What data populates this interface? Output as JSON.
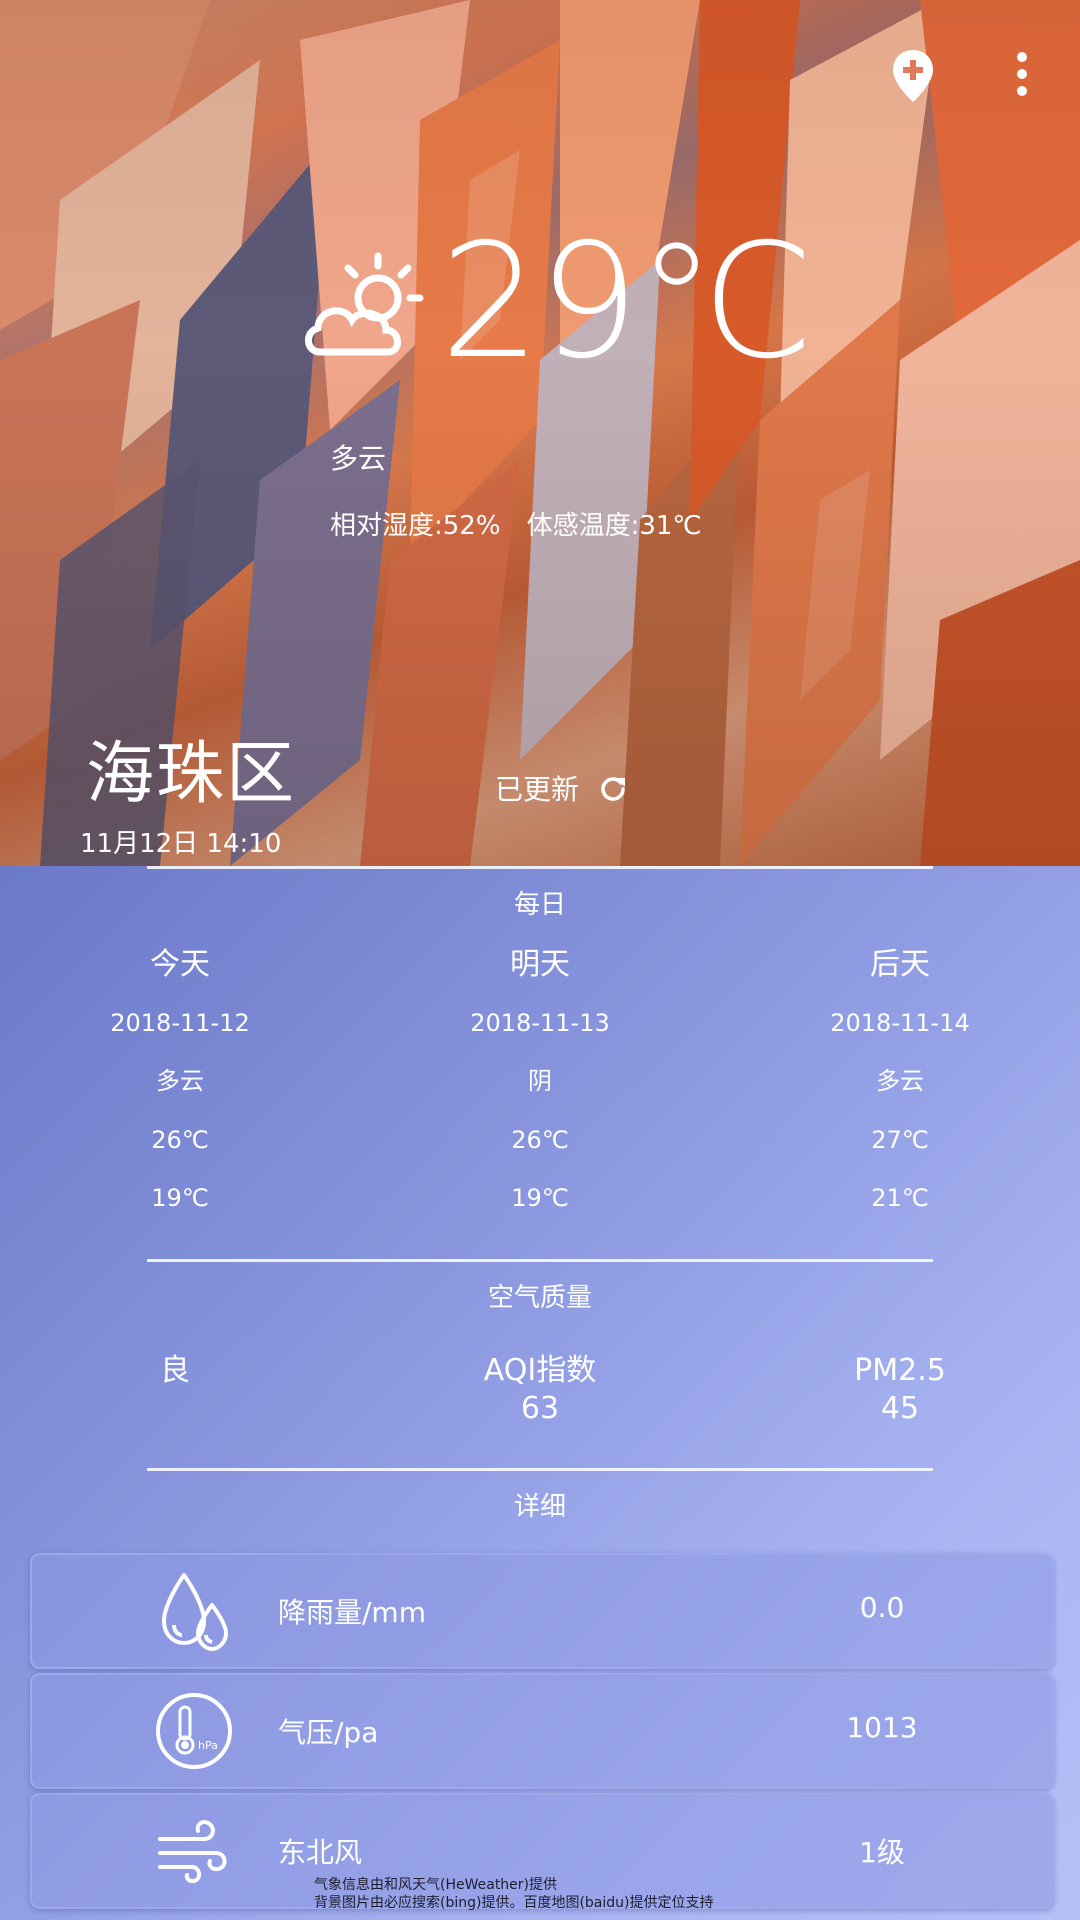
{
  "current": {
    "temperature": "29℃",
    "condition": "多云",
    "humidity": "相对湿度:52%",
    "feels_like": "体感温度:31℃",
    "weather_icon": "partly-cloudy-icon"
  },
  "location": {
    "city": "海珠区",
    "datetime": "11月12日 14:10",
    "updated_label": "已更新"
  },
  "daily": {
    "title": "每日",
    "days": [
      {
        "label": "今天",
        "date": "2018-11-12",
        "weather": "多云",
        "high": "26℃",
        "low": "19℃"
      },
      {
        "label": "明天",
        "date": "2018-11-13",
        "weather": "阴",
        "high": "26℃",
        "low": "19℃"
      },
      {
        "label": "后天",
        "date": "2018-11-14",
        "weather": "多云",
        "high": "27℃",
        "low": "21℃"
      }
    ]
  },
  "air_quality": {
    "title": "空气质量",
    "level": "良",
    "aqi_label": "AQI指数",
    "aqi_value": "63",
    "pm25_label": "PM2.5",
    "pm25_value": "45"
  },
  "details": {
    "title": "详细",
    "items": [
      {
        "icon": "raindrops-icon",
        "label": "降雨量/mm",
        "value": "0.0"
      },
      {
        "icon": "barometer-icon",
        "label": "气压/pa",
        "value": "1013"
      },
      {
        "icon": "wind-icon",
        "label": "东北风",
        "value": "1级"
      }
    ]
  },
  "credits": {
    "line1": "气象信息由和风天气(HeWeather)提供",
    "line2": "背景图片由必应搜索(bing)提供。百度地图(baidu)提供定位支持"
  },
  "colors": {
    "panel_start": "#6a79c8",
    "panel_end": "#b6c0f8",
    "text": "#ffffff"
  }
}
